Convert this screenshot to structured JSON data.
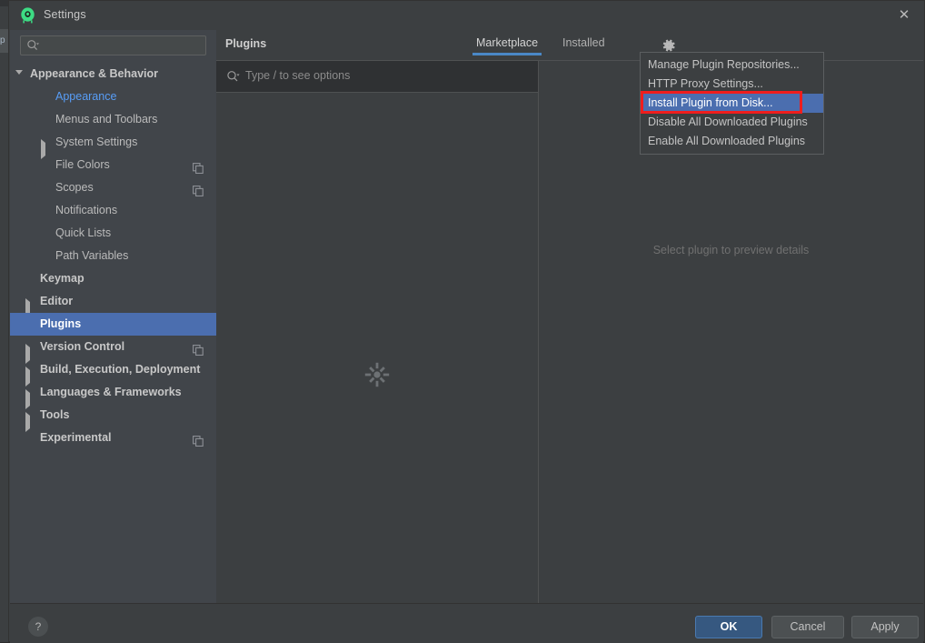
{
  "window": {
    "title": "Settings",
    "app_icon": "android-studio-icon",
    "close_label": "✕"
  },
  "sidebar": {
    "search": {
      "value": "",
      "icon": "search-icon"
    },
    "items": [
      {
        "label": "Appearance & Behavior",
        "indent": 22,
        "arrow": "down",
        "bold": true,
        "selected": false,
        "badge": null,
        "link": false
      },
      {
        "label": "Appearance",
        "indent": 50,
        "arrow": "none",
        "bold": false,
        "selected": false,
        "badge": null,
        "link": true
      },
      {
        "label": "Menus and Toolbars",
        "indent": 50,
        "arrow": "none",
        "bold": false,
        "selected": false,
        "badge": null,
        "link": false
      },
      {
        "label": "System Settings",
        "indent": 50,
        "arrow": "right",
        "bold": false,
        "selected": false,
        "badge": null,
        "link": false
      },
      {
        "label": "File Colors",
        "indent": 50,
        "arrow": "none",
        "bold": false,
        "selected": false,
        "badge": "copy-icon",
        "link": false
      },
      {
        "label": "Scopes",
        "indent": 50,
        "arrow": "none",
        "bold": false,
        "selected": false,
        "badge": "copy-icon",
        "link": false
      },
      {
        "label": "Notifications",
        "indent": 50,
        "arrow": "none",
        "bold": false,
        "selected": false,
        "badge": null,
        "link": false
      },
      {
        "label": "Quick Lists",
        "indent": 50,
        "arrow": "none",
        "bold": false,
        "selected": false,
        "badge": null,
        "link": false
      },
      {
        "label": "Path Variables",
        "indent": 50,
        "arrow": "none",
        "bold": false,
        "selected": false,
        "badge": null,
        "link": false
      },
      {
        "label": "Keymap",
        "indent": 33,
        "arrow": "none",
        "bold": true,
        "selected": false,
        "badge": null,
        "link": false
      },
      {
        "label": "Editor",
        "indent": 33,
        "arrow": "right",
        "bold": true,
        "selected": false,
        "badge": null,
        "link": false
      },
      {
        "label": "Plugins",
        "indent": 33,
        "arrow": "none",
        "bold": true,
        "selected": true,
        "badge": null,
        "link": false
      },
      {
        "label": "Version Control",
        "indent": 33,
        "arrow": "right",
        "bold": true,
        "selected": false,
        "badge": "copy-icon",
        "link": false
      },
      {
        "label": "Build, Execution, Deployment",
        "indent": 33,
        "arrow": "right",
        "bold": true,
        "selected": false,
        "badge": null,
        "link": false
      },
      {
        "label": "Languages & Frameworks",
        "indent": 33,
        "arrow": "right",
        "bold": true,
        "selected": false,
        "badge": null,
        "link": false
      },
      {
        "label": "Tools",
        "indent": 33,
        "arrow": "right",
        "bold": true,
        "selected": false,
        "badge": null,
        "link": false
      },
      {
        "label": "Experimental",
        "indent": 33,
        "arrow": "none",
        "bold": true,
        "selected": false,
        "badge": "copy-icon",
        "link": false
      }
    ]
  },
  "content": {
    "page_title": "Plugins",
    "tabs": [
      {
        "label": "Marketplace",
        "active": true
      },
      {
        "label": "Installed",
        "active": false
      }
    ],
    "gear_icon": "gear-icon",
    "search": {
      "placeholder": "Type / to see options",
      "value": "",
      "icon": "search-icon"
    },
    "list_status_icon": "loading-spinner-icon",
    "detail_hint": "Select plugin to preview details"
  },
  "popup_menu": {
    "items": [
      {
        "label": "Manage Plugin Repositories...",
        "highlight": false
      },
      {
        "label": "HTTP Proxy Settings...",
        "highlight": false
      },
      {
        "label": "Install Plugin from Disk...",
        "highlight": true
      },
      {
        "label": "Disable All Downloaded Plugins",
        "highlight": false
      },
      {
        "label": "Enable All Downloaded Plugins",
        "highlight": false
      }
    ],
    "annotation_color": "#ef1d1d"
  },
  "footer": {
    "help_label": "?",
    "ok_label": "OK",
    "cancel_label": "Cancel",
    "apply_label": "Apply"
  },
  "colors": {
    "accent_blue": "#4b6eaf",
    "tab_underline": "#4a88c7",
    "dialog_bg": "#3c3f41",
    "sidebar_bg": "#41454a",
    "link_blue": "#589df6"
  }
}
